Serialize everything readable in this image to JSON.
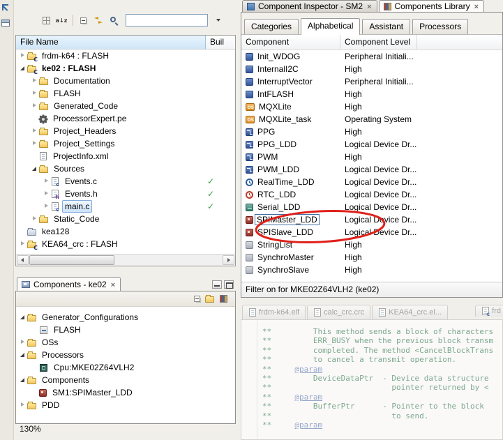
{
  "zoom": {
    "label": "130%"
  },
  "explorer": {
    "filter_value": "",
    "columns": [
      "File Name",
      "Buil"
    ],
    "tree": [
      {
        "label": "frdm-k64 : FLASH",
        "indent": 0,
        "expander": "collapsed",
        "icon": "c-project-icon"
      },
      {
        "label": "ke02 : FLASH",
        "indent": 0,
        "expander": "expanded",
        "icon": "c-project-icon",
        "bold": true
      },
      {
        "label": "Documentation",
        "indent": 1,
        "expander": "collapsed",
        "icon": "folder-icon"
      },
      {
        "label": "FLASH",
        "indent": 1,
        "expander": "collapsed",
        "icon": "folder-icon"
      },
      {
        "label": "Generated_Code",
        "indent": 1,
        "expander": "collapsed",
        "icon": "folder-icon"
      },
      {
        "label": "ProcessorExpert.pe",
        "indent": 1,
        "expander": "none",
        "icon": "gear-icon"
      },
      {
        "label": "Project_Headers",
        "indent": 1,
        "expander": "collapsed",
        "icon": "folder-icon"
      },
      {
        "label": "Project_Settings",
        "indent": 1,
        "expander": "collapsed",
        "icon": "folder-icon"
      },
      {
        "label": "ProjectInfo.xml",
        "indent": 1,
        "expander": "none",
        "icon": "xml-file-icon"
      },
      {
        "label": "Sources",
        "indent": 1,
        "expander": "expanded",
        "icon": "folder-icon"
      },
      {
        "label": "Events.c",
        "indent": 2,
        "expander": "collapsed",
        "icon": "c-file-icon",
        "check": true
      },
      {
        "label": "Events.h",
        "indent": 2,
        "expander": "collapsed",
        "icon": "h-file-icon",
        "check": true
      },
      {
        "label": "main.c",
        "indent": 2,
        "expander": "collapsed",
        "icon": "c-file-icon",
        "check": true,
        "selected": true
      },
      {
        "label": "Static_Code",
        "indent": 1,
        "expander": "collapsed",
        "icon": "folder-icon"
      },
      {
        "label": "kea128",
        "indent": 0,
        "expander": "none",
        "icon": "closed-project-icon"
      },
      {
        "label": "KEA64_crc : FLASH",
        "indent": 0,
        "expander": "collapsed",
        "icon": "c-project-icon"
      }
    ]
  },
  "components_view": {
    "title": "Components - ke02",
    "tree": [
      {
        "label": "Generator_Configurations",
        "indent": 0,
        "expander": "expanded",
        "icon": "folder-icon"
      },
      {
        "label": "FLASH",
        "indent": 1,
        "expander": "none",
        "icon": "config-icon"
      },
      {
        "label": "OSs",
        "indent": 0,
        "expander": "collapsed",
        "icon": "folder-icon"
      },
      {
        "label": "Processors",
        "indent": 0,
        "expander": "expanded",
        "icon": "folder-icon"
      },
      {
        "label": "Cpu:MKE02Z64VLH2",
        "indent": 1,
        "expander": "none",
        "icon": "chip-icon"
      },
      {
        "label": "Components",
        "indent": 0,
        "expander": "expanded",
        "icon": "folder-icon"
      },
      {
        "label": "SM1:SPIMaster_LDD",
        "indent": 1,
        "expander": "none",
        "icon": "spi-icon"
      },
      {
        "label": "PDD",
        "indent": 0,
        "expander": "collapsed",
        "icon": "folder-icon"
      }
    ]
  },
  "library_view": {
    "view_tabs": [
      {
        "label": "Component Inspector - SM2",
        "icon": "inspector-icon",
        "active": false
      },
      {
        "label": "Components Library",
        "icon": "library-icon",
        "active": true
      }
    ],
    "tabs": [
      {
        "label": "Categories",
        "active": false
      },
      {
        "label": "Alphabetical",
        "active": true
      },
      {
        "label": "Assistant",
        "active": false
      },
      {
        "label": "Processors",
        "active": false
      }
    ],
    "columns": [
      "Component",
      "Component Level"
    ],
    "rows": [
      {
        "name": "Init_WDOG",
        "level": "Peripheral Initiali...",
        "icon": "periph-icon"
      },
      {
        "name": "InternalI2C",
        "level": "High",
        "icon": "periph-icon"
      },
      {
        "name": "InterruptVector",
        "level": "Peripheral Initiali...",
        "icon": "periph-icon"
      },
      {
        "name": "IntFLASH",
        "level": "High",
        "icon": "periph-icon"
      },
      {
        "name": "MQXLite",
        "level": "High",
        "icon": "os-icon"
      },
      {
        "name": "MQXLite_task",
        "level": "Operating System",
        "icon": "os-icon"
      },
      {
        "name": "PPG",
        "level": "High",
        "icon": "wave-icon"
      },
      {
        "name": "PPG_LDD",
        "level": "Logical Device Dr...",
        "icon": "wave-icon"
      },
      {
        "name": "PWM",
        "level": "High",
        "icon": "wave-icon"
      },
      {
        "name": "PWM_LDD",
        "level": "Logical Device Dr...",
        "icon": "wave-icon"
      },
      {
        "name": "RealTime_LDD",
        "level": "Logical Device Dr...",
        "icon": "clock-icon"
      },
      {
        "name": "RTC_LDD",
        "level": "Logical Device Dr...",
        "icon": "rtc-icon"
      },
      {
        "name": "Serial_LDD",
        "level": "Logical Device Dr...",
        "icon": "serial-icon"
      },
      {
        "name": "SPIMaster_LDD",
        "level": "Logical Device Dr...",
        "icon": "spi-icon",
        "focused": true
      },
      {
        "name": "SPISlave_LDD",
        "level": "Logical Device Dr...",
        "icon": "spi-icon"
      },
      {
        "name": "StringList",
        "level": "High",
        "icon": "generic-icon"
      },
      {
        "name": "SynchroMaster",
        "level": "High",
        "icon": "generic-icon"
      },
      {
        "name": "SynchroSlave",
        "level": "High",
        "icon": "generic-icon"
      }
    ],
    "filter_status": "Filter on for MKE02Z64VLH2 (ke02)"
  },
  "annotation": {
    "circled_component": "SPIMaster_LDD",
    "color": "#e0201a"
  },
  "editor": {
    "tabs": [
      {
        "label": "frdm-k64.elf",
        "icon": "elf-file-icon"
      },
      {
        "label": "calc_crc.crc",
        "icon": "crc-file-icon"
      },
      {
        "label": "KEA64_crc.el...",
        "icon": "elf-file-icon"
      },
      {
        "label": "frd",
        "icon": "c-file-icon",
        "pinned_right": true
      }
    ],
    "code_lines": [
      "**         This method sends a block of characters",
      "**         ERR_BUSY when the previous block transm",
      "**         completed. The method <CancelBlockTrans",
      "**         to cancel a transmit operation.",
      "**     @param",
      "**         DeviceDataPtr  - Device data structure",
      "**                          pointer returned by <",
      "**     @param",
      "**         BufferPtr      - Pointer to the block",
      "**                          to send.",
      "**     @param"
    ]
  }
}
